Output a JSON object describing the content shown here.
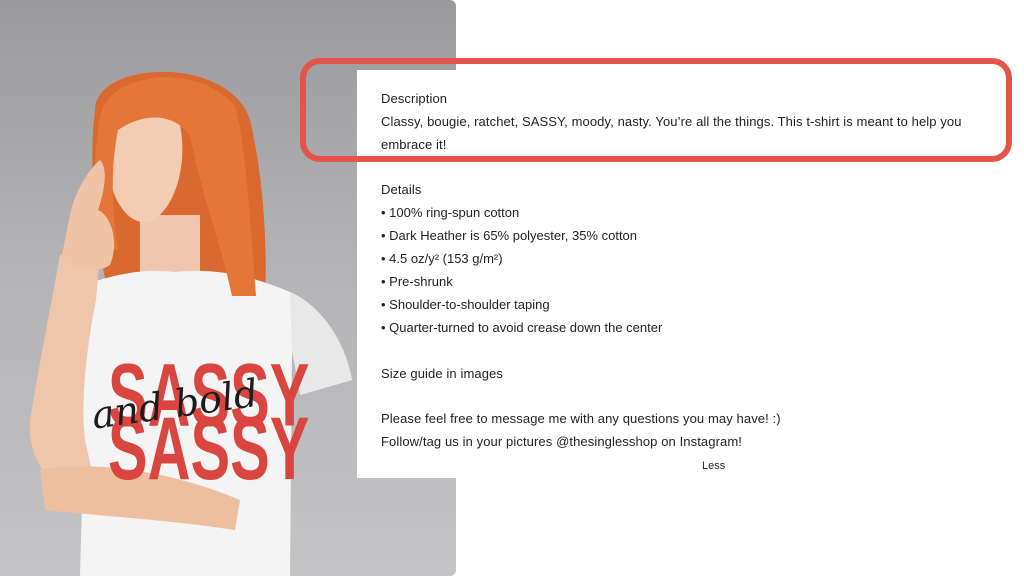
{
  "product_image": {
    "shirt_text_main": "SASSY",
    "shirt_text_script": "and bold",
    "shirt_text_color": "#d9453f",
    "hair_color": "#e5763a",
    "background_color": "#b3b3b5"
  },
  "description": {
    "heading": "Description",
    "body": "Classy, bougie, ratchet, SASSY, moody, nasty. You’re all the things. This t-shirt is meant to help you embrace it!"
  },
  "details": {
    "heading": "Details",
    "items": [
      "• 100% ring-spun cotton",
      "• Dark Heather is 65% polyester, 35% cotton",
      "• 4.5 oz/y² (153 g/m²)",
      "• Pre-shrunk",
      "• Shoulder-to-shoulder taping",
      "• Quarter-turned to avoid crease down the center"
    ]
  },
  "size_guide": "Size guide in images",
  "message": "Please feel free to message me with any questions you may have! :)",
  "follow": "Follow/tag us in your pictures @thesinglesshop on Instagram!",
  "less_link": "Less",
  "highlight": {
    "color": "#e4544a"
  }
}
